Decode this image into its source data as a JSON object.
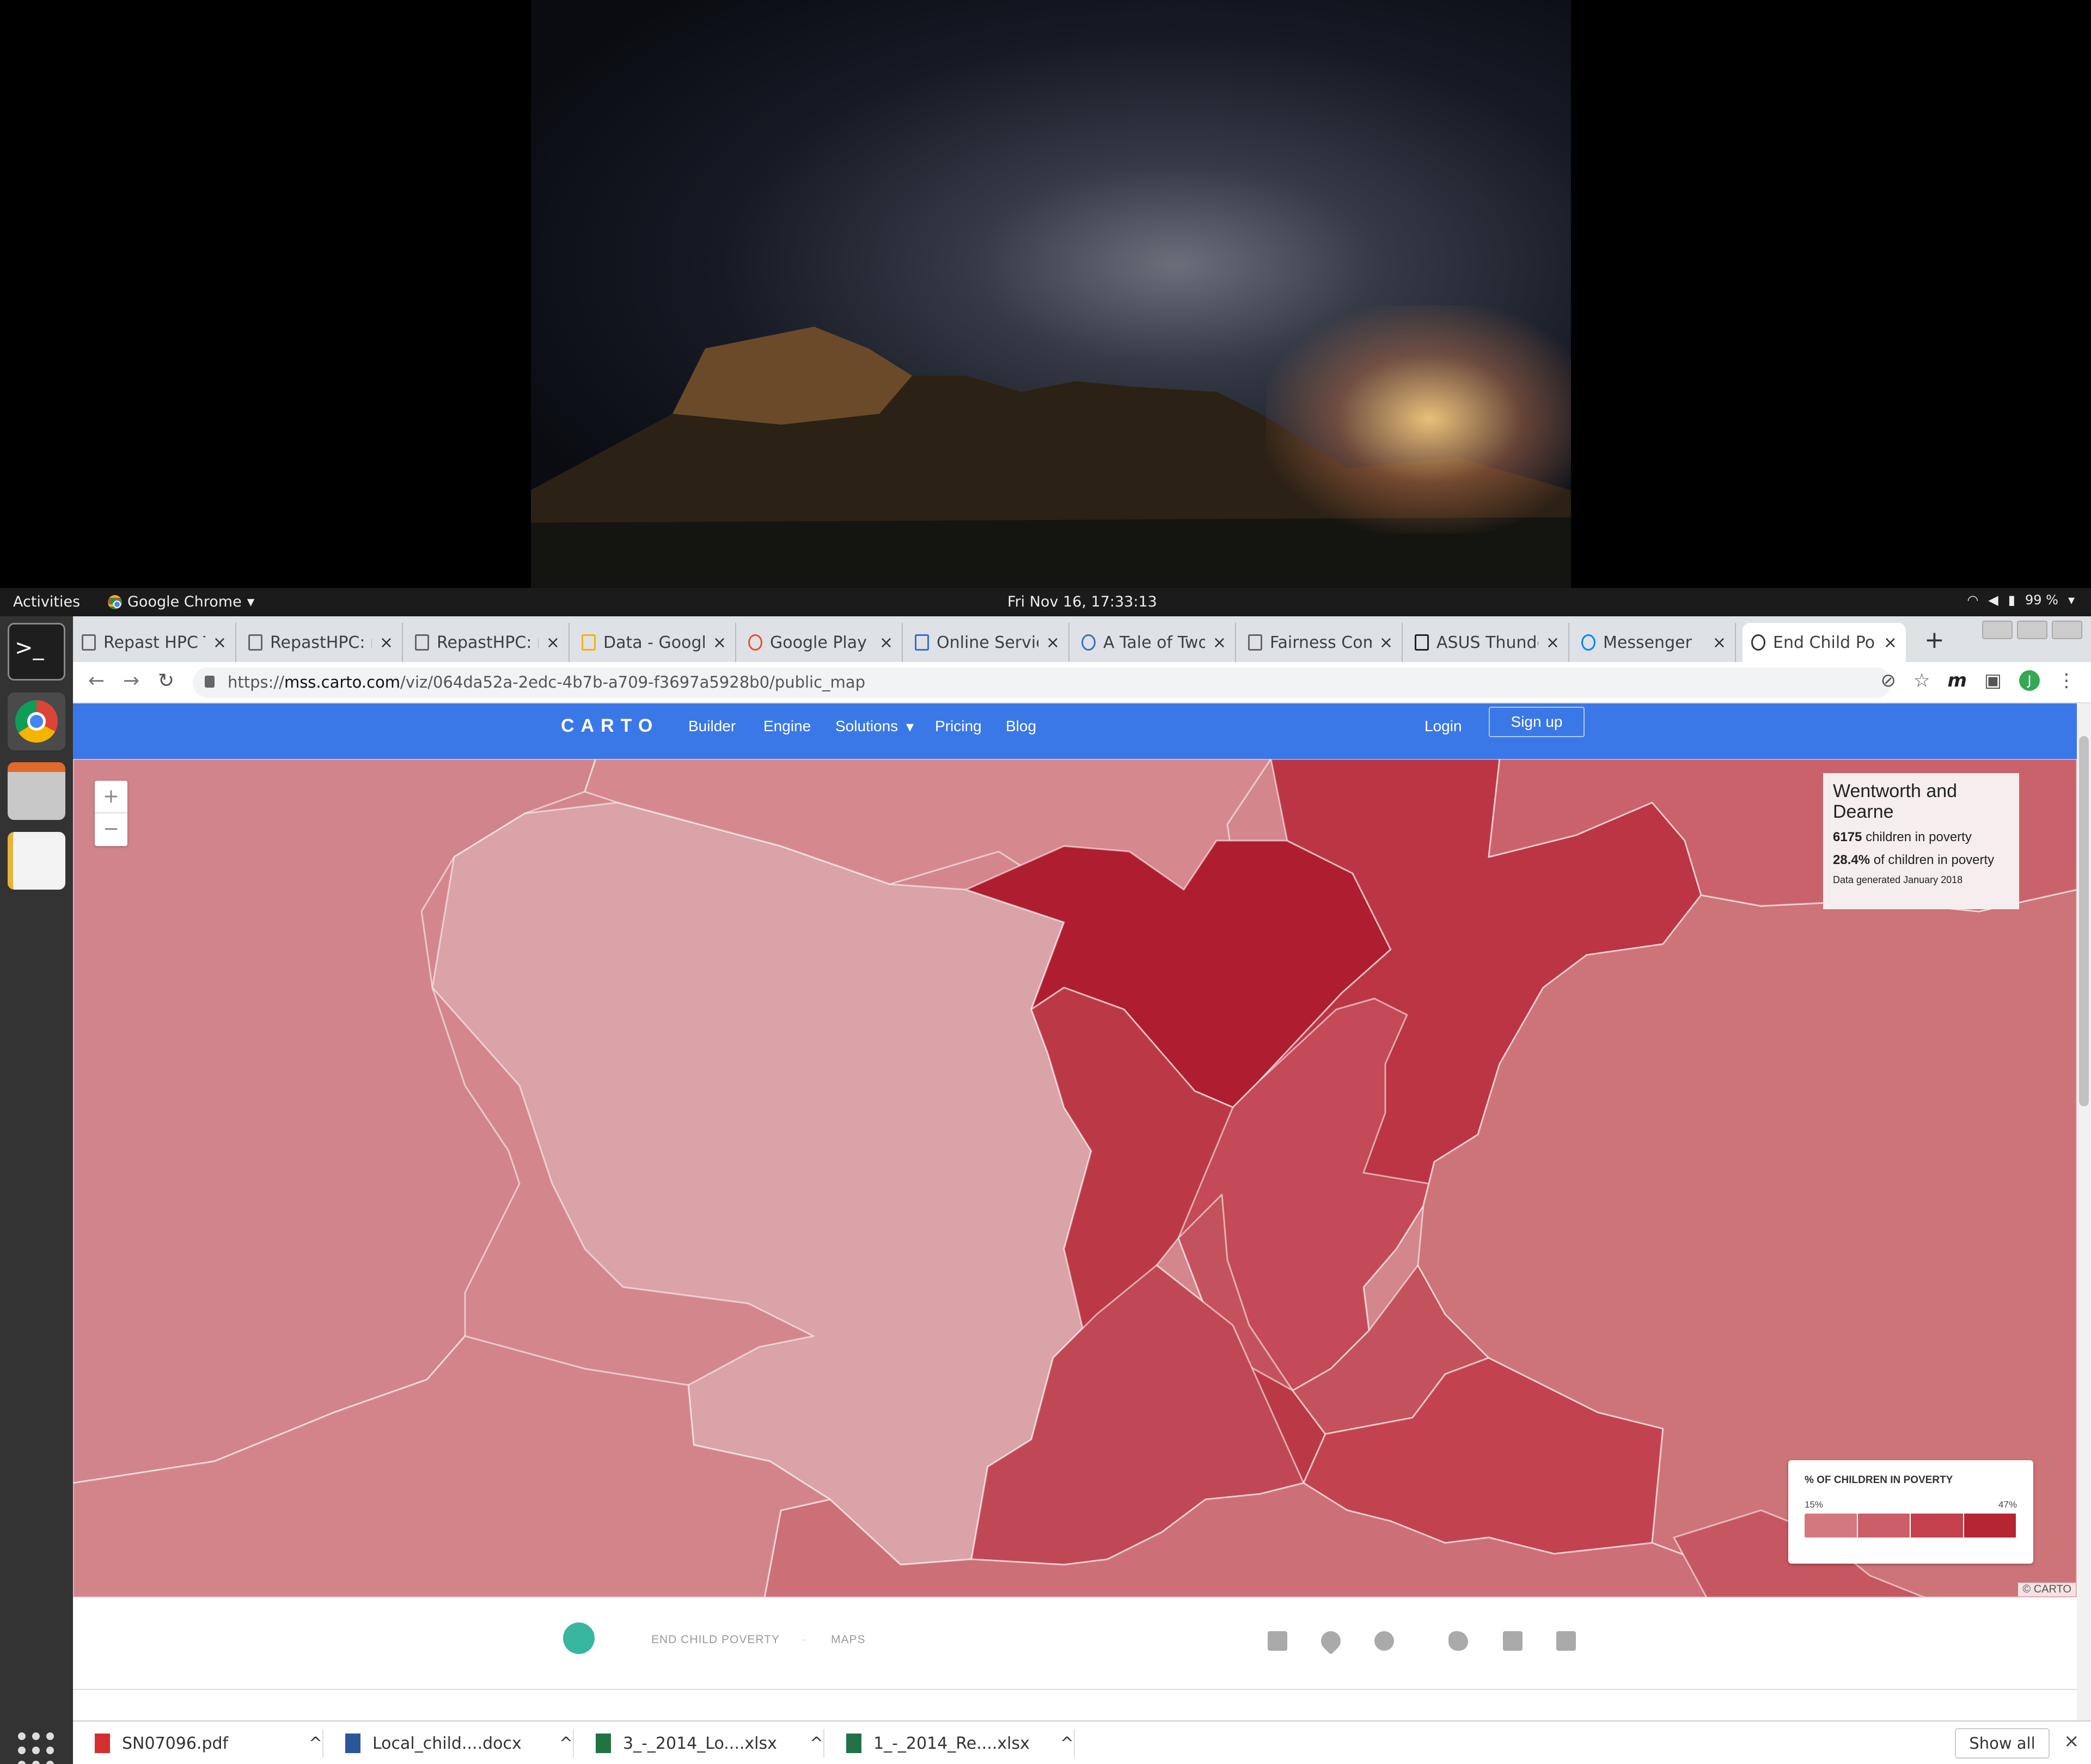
{
  "topbar": {
    "activities": "Activities",
    "app_name": "Google Chrome",
    "clock": "Fri Nov 16, 17:33:13",
    "battery": "99 %"
  },
  "tabs": [
    {
      "label": "Repast HPC T"
    },
    {
      "label": "RepastHPC: r"
    },
    {
      "label": "RepastHPC: r"
    },
    {
      "label": "Data - Google"
    },
    {
      "label": "Google Play f"
    },
    {
      "label": "Online Servic"
    },
    {
      "label": "A Tale of Two"
    },
    {
      "label": "Fairness Com"
    },
    {
      "label": "ASUS Thunde"
    },
    {
      "label": "Messenger"
    },
    {
      "label": "End Child Po"
    }
  ],
  "omnibox": {
    "scheme": "https://",
    "host": "mss.carto.com",
    "path": "/viz/064da52a-2edc-4b7b-a709-f3697a5928b0/public_map",
    "avatar": "J"
  },
  "carto_nav": {
    "logo": "CARTO",
    "items": [
      "Builder",
      "Engine",
      "Solutions",
      "Pricing",
      "Blog"
    ],
    "login": "Login",
    "signup": "Sign up"
  },
  "map": {
    "zoom_in": "+",
    "zoom_out": "−",
    "info": {
      "title": "Wentworth and Dearne",
      "children_count": "6175",
      "children_text": "children in poverty",
      "percent": "28.4%",
      "percent_text": "of children in poverty",
      "note": "Data generated January 2018"
    },
    "legend": {
      "title": "% OF CHILDREN IN POVERTY",
      "min": "15%",
      "max": "47%",
      "colors": [
        "#d3787f",
        "#cc5e68",
        "#c3404c",
        "#b52532"
      ]
    },
    "attribution": "© CARTO"
  },
  "footer": {
    "links": [
      "END CHILD POVERTY",
      "MAPS"
    ]
  },
  "downloads": [
    {
      "name": "SN07096.pdf",
      "color": "#d32f2f"
    },
    {
      "name": "Local_child....docx",
      "color": "#2b579a"
    },
    {
      "name": "3_-_2014_Lo....xlsx",
      "color": "#217346"
    },
    {
      "name": "1_-_2014_Re....xlsx",
      "color": "#217346"
    }
  ],
  "show_all": "Show all"
}
